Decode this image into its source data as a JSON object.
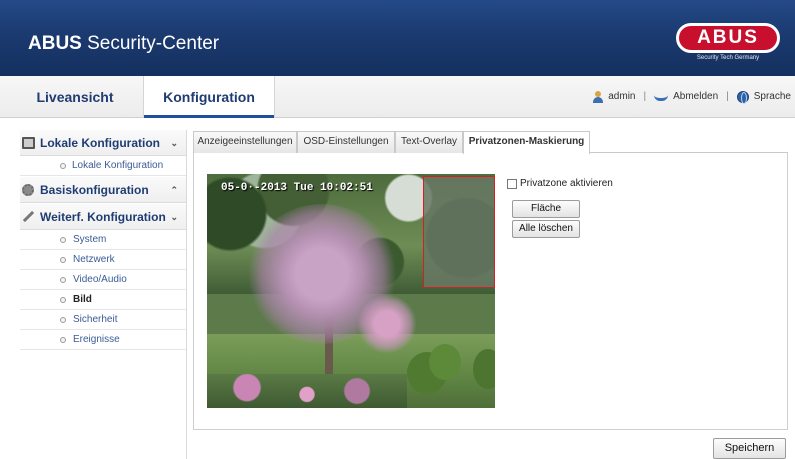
{
  "header": {
    "title_bold": "ABUS",
    "title_rest": " Security-Center",
    "logo_text": "ABUS",
    "logo_tagline": "Security Tech Germany",
    "brand_color": "#1b3a70",
    "logo_color": "#c8102e"
  },
  "topnav": {
    "tabs": [
      {
        "label": "Liveansicht"
      },
      {
        "label": "Konfiguration"
      }
    ],
    "active_tab": "Konfiguration",
    "user": "admin",
    "separator": "|",
    "logout": "Abmelden",
    "language": "Sprache"
  },
  "sidebar": {
    "sections": [
      {
        "label": "Lokale Konfiguration",
        "chevron": "⌄",
        "icon": "monitor-icon"
      },
      {
        "label": "Basiskonfiguration",
        "chevron": "⌃",
        "icon": "gear-icon"
      },
      {
        "label": "Weiterf. Konfiguration",
        "chevron": "⌄",
        "icon": "wrench-icon"
      }
    ],
    "local_items": [
      "Lokale Konfiguration"
    ],
    "advanced_items": [
      "System",
      "Netzwerk",
      "Video/Audio",
      "Bild",
      "Sicherheit",
      "Ereignisse"
    ],
    "active_item": "Bild"
  },
  "tabs": [
    {
      "label": "Anzeigeeinstellungen"
    },
    {
      "label": "OSD-Einstellungen"
    },
    {
      "label": "Text-Overlay"
    },
    {
      "label": "Privatzonen-Maskierung"
    }
  ],
  "active_content_tab": "Privatzonen-Maskierung",
  "camera": {
    "osd": "05-0·-2013 Tue 10:02:51"
  },
  "controls": {
    "checkbox_label": "Privatzone aktivieren",
    "checkbox_checked": false,
    "area_button": "Fläche",
    "clear_all_button": "Alle löschen",
    "save_button": "Speichern"
  }
}
